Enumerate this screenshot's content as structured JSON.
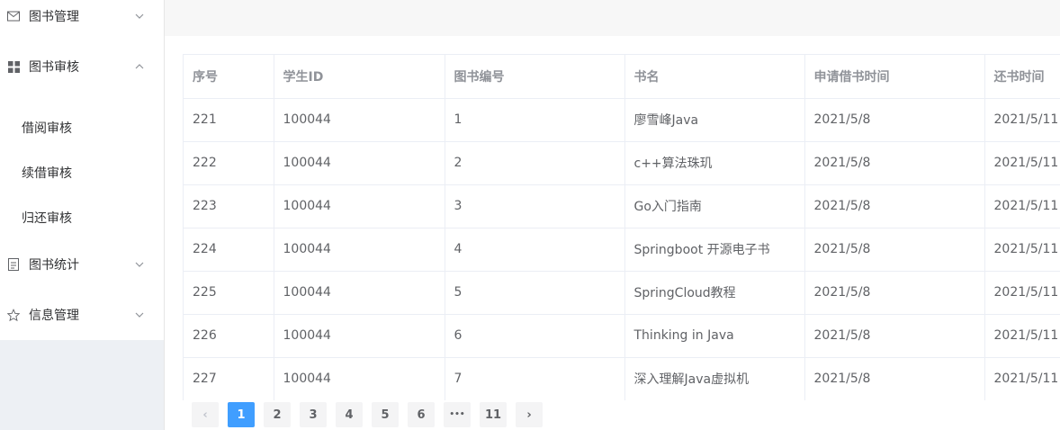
{
  "sidebar": {
    "menus": [
      {
        "label": "图书管理",
        "icon": "mail-icon",
        "arrow": "chevron-down-icon"
      },
      {
        "label": "图书审核",
        "icon": "grid-icon",
        "arrow": "chevron-up-icon"
      },
      {
        "label": "图书统计",
        "icon": "document-icon",
        "arrow": "chevron-down-icon"
      },
      {
        "label": "信息管理",
        "icon": "star-icon",
        "arrow": "chevron-down-icon"
      }
    ],
    "submenu": [
      "借阅审核",
      "续借审核",
      "归还审核"
    ]
  },
  "table": {
    "columns": [
      "序号",
      "学生ID",
      "图书编号",
      "书名",
      "申请借书时间",
      "还书时间"
    ],
    "rows": [
      [
        "221",
        "100044",
        "1",
        "廖雪峰Java",
        "2021/5/8",
        "2021/5/11"
      ],
      [
        "222",
        "100044",
        "2",
        "c++算法珠玑",
        "2021/5/8",
        "2021/5/11"
      ],
      [
        "223",
        "100044",
        "3",
        "Go入门指南",
        "2021/5/8",
        "2021/5/11"
      ],
      [
        "224",
        "100044",
        "4",
        "Springboot 开源电子书",
        "2021/5/8",
        "2021/5/11"
      ],
      [
        "225",
        "100044",
        "5",
        "SpringCloud教程",
        "2021/5/8",
        "2021/5/11"
      ],
      [
        "226",
        "100044",
        "6",
        "Thinking in Java",
        "2021/5/8",
        "2021/5/11"
      ],
      [
        "227",
        "100044",
        "7",
        "深入理解Java虚拟机",
        "2021/5/8",
        "2021/5/11"
      ]
    ]
  },
  "pagination": {
    "prev": "‹",
    "pages": [
      "1",
      "2",
      "3",
      "4",
      "5",
      "6"
    ],
    "ellipsis": "•••",
    "last": "11",
    "next": "›",
    "current": "1"
  },
  "colors": {
    "accent": "#409eff",
    "sidebar_bg": "#edf0f4",
    "header_bg": "#f7f7f7"
  }
}
